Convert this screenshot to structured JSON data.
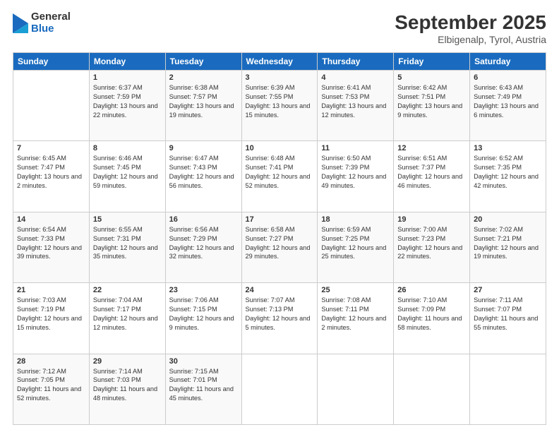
{
  "header": {
    "logo_general": "General",
    "logo_blue": "Blue",
    "month_title": "September 2025",
    "location": "Elbigenalp, Tyrol, Austria"
  },
  "days_of_week": [
    "Sunday",
    "Monday",
    "Tuesday",
    "Wednesday",
    "Thursday",
    "Friday",
    "Saturday"
  ],
  "weeks": [
    [
      {
        "day": "",
        "text": ""
      },
      {
        "day": "1",
        "text": "Sunrise: 6:37 AM\nSunset: 7:59 PM\nDaylight: 13 hours\nand 22 minutes."
      },
      {
        "day": "2",
        "text": "Sunrise: 6:38 AM\nSunset: 7:57 PM\nDaylight: 13 hours\nand 19 minutes."
      },
      {
        "day": "3",
        "text": "Sunrise: 6:39 AM\nSunset: 7:55 PM\nDaylight: 13 hours\nand 15 minutes."
      },
      {
        "day": "4",
        "text": "Sunrise: 6:41 AM\nSunset: 7:53 PM\nDaylight: 13 hours\nand 12 minutes."
      },
      {
        "day": "5",
        "text": "Sunrise: 6:42 AM\nSunset: 7:51 PM\nDaylight: 13 hours\nand 9 minutes."
      },
      {
        "day": "6",
        "text": "Sunrise: 6:43 AM\nSunset: 7:49 PM\nDaylight: 13 hours\nand 6 minutes."
      }
    ],
    [
      {
        "day": "7",
        "text": "Sunrise: 6:45 AM\nSunset: 7:47 PM\nDaylight: 13 hours\nand 2 minutes."
      },
      {
        "day": "8",
        "text": "Sunrise: 6:46 AM\nSunset: 7:45 PM\nDaylight: 12 hours\nand 59 minutes."
      },
      {
        "day": "9",
        "text": "Sunrise: 6:47 AM\nSunset: 7:43 PM\nDaylight: 12 hours\nand 56 minutes."
      },
      {
        "day": "10",
        "text": "Sunrise: 6:48 AM\nSunset: 7:41 PM\nDaylight: 12 hours\nand 52 minutes."
      },
      {
        "day": "11",
        "text": "Sunrise: 6:50 AM\nSunset: 7:39 PM\nDaylight: 12 hours\nand 49 minutes."
      },
      {
        "day": "12",
        "text": "Sunrise: 6:51 AM\nSunset: 7:37 PM\nDaylight: 12 hours\nand 46 minutes."
      },
      {
        "day": "13",
        "text": "Sunrise: 6:52 AM\nSunset: 7:35 PM\nDaylight: 12 hours\nand 42 minutes."
      }
    ],
    [
      {
        "day": "14",
        "text": "Sunrise: 6:54 AM\nSunset: 7:33 PM\nDaylight: 12 hours\nand 39 minutes."
      },
      {
        "day": "15",
        "text": "Sunrise: 6:55 AM\nSunset: 7:31 PM\nDaylight: 12 hours\nand 35 minutes."
      },
      {
        "day": "16",
        "text": "Sunrise: 6:56 AM\nSunset: 7:29 PM\nDaylight: 12 hours\nand 32 minutes."
      },
      {
        "day": "17",
        "text": "Sunrise: 6:58 AM\nSunset: 7:27 PM\nDaylight: 12 hours\nand 29 minutes."
      },
      {
        "day": "18",
        "text": "Sunrise: 6:59 AM\nSunset: 7:25 PM\nDaylight: 12 hours\nand 25 minutes."
      },
      {
        "day": "19",
        "text": "Sunrise: 7:00 AM\nSunset: 7:23 PM\nDaylight: 12 hours\nand 22 minutes."
      },
      {
        "day": "20",
        "text": "Sunrise: 7:02 AM\nSunset: 7:21 PM\nDaylight: 12 hours\nand 19 minutes."
      }
    ],
    [
      {
        "day": "21",
        "text": "Sunrise: 7:03 AM\nSunset: 7:19 PM\nDaylight: 12 hours\nand 15 minutes."
      },
      {
        "day": "22",
        "text": "Sunrise: 7:04 AM\nSunset: 7:17 PM\nDaylight: 12 hours\nand 12 minutes."
      },
      {
        "day": "23",
        "text": "Sunrise: 7:06 AM\nSunset: 7:15 PM\nDaylight: 12 hours\nand 9 minutes."
      },
      {
        "day": "24",
        "text": "Sunrise: 7:07 AM\nSunset: 7:13 PM\nDaylight: 12 hours\nand 5 minutes."
      },
      {
        "day": "25",
        "text": "Sunrise: 7:08 AM\nSunset: 7:11 PM\nDaylight: 12 hours\nand 2 minutes."
      },
      {
        "day": "26",
        "text": "Sunrise: 7:10 AM\nSunset: 7:09 PM\nDaylight: 11 hours\nand 58 minutes."
      },
      {
        "day": "27",
        "text": "Sunrise: 7:11 AM\nSunset: 7:07 PM\nDaylight: 11 hours\nand 55 minutes."
      }
    ],
    [
      {
        "day": "28",
        "text": "Sunrise: 7:12 AM\nSunset: 7:05 PM\nDaylight: 11 hours\nand 52 minutes."
      },
      {
        "day": "29",
        "text": "Sunrise: 7:14 AM\nSunset: 7:03 PM\nDaylight: 11 hours\nand 48 minutes."
      },
      {
        "day": "30",
        "text": "Sunrise: 7:15 AM\nSunset: 7:01 PM\nDaylight: 11 hours\nand 45 minutes."
      },
      {
        "day": "",
        "text": ""
      },
      {
        "day": "",
        "text": ""
      },
      {
        "day": "",
        "text": ""
      },
      {
        "day": "",
        "text": ""
      }
    ]
  ]
}
